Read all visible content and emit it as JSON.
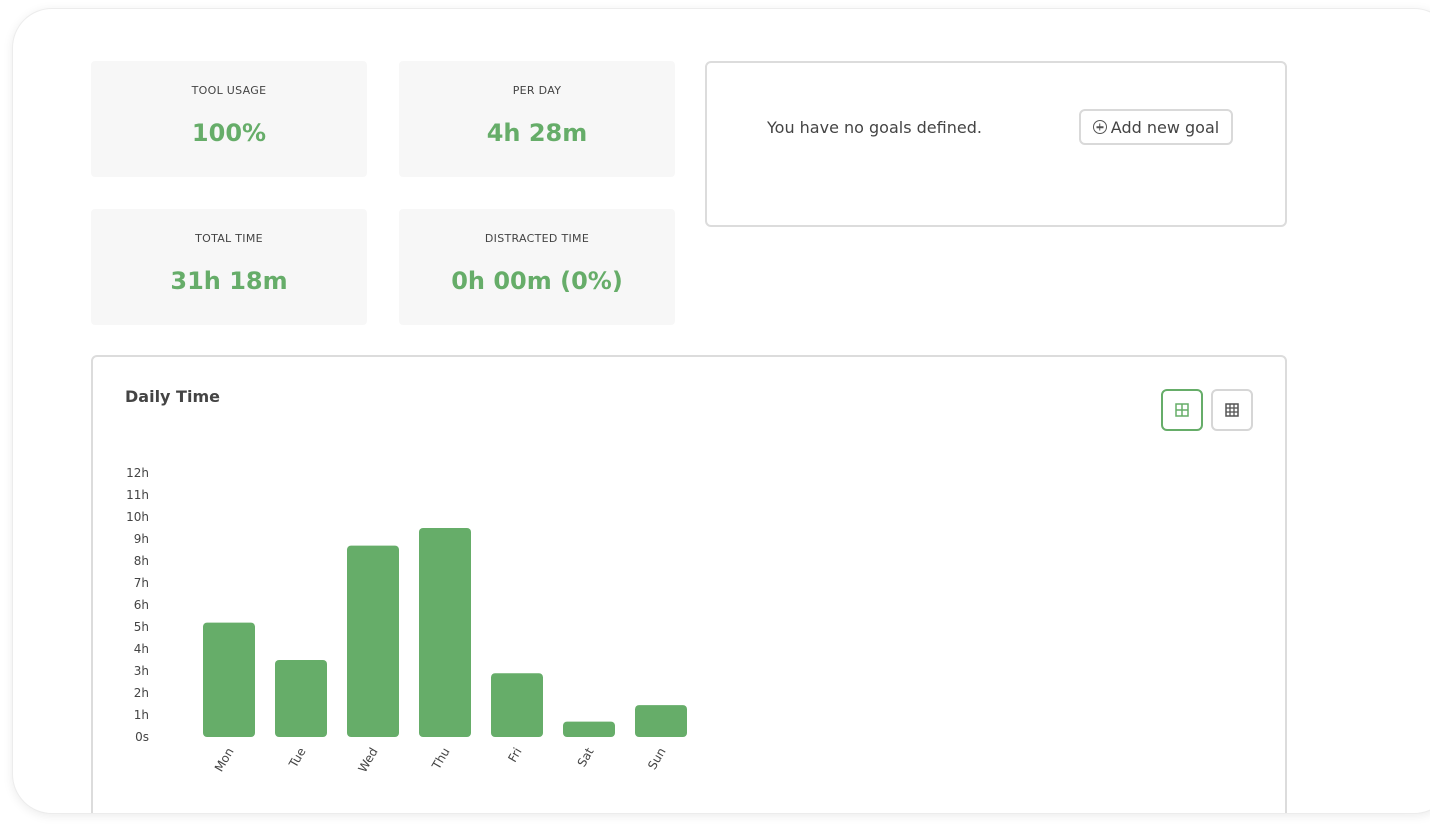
{
  "stats": {
    "tool_usage": {
      "label": "TOOL USAGE",
      "value": "100%"
    },
    "per_day": {
      "label": "PER DAY",
      "value": "4h 28m"
    },
    "total_time": {
      "label": "TOTAL TIME",
      "value": "31h 18m"
    },
    "distracted_time": {
      "label": "DISTRACTED TIME",
      "value": "0h 00m (0%)"
    }
  },
  "goals": {
    "empty_text": "You have no goals defined.",
    "add_button_label": "Add new goal",
    "add_icon": "plus-circle-icon"
  },
  "view_toggle": {
    "active_icon": "grid-2x2-icon",
    "inactive_icon": "grid-3x3-icon",
    "active_color": "#66ad69"
  },
  "colors": {
    "accent": "#66ad69",
    "bar": "#66ad69"
  },
  "chart_data": {
    "type": "bar",
    "title": "Daily Time",
    "categories": [
      "Mon",
      "Tue",
      "Wed",
      "Thu",
      "Fri",
      "Sat",
      "Sun"
    ],
    "values": [
      5.2,
      3.5,
      8.7,
      9.5,
      2.9,
      0.7,
      1.45
    ],
    "ylim": [
      0,
      12
    ],
    "yticks": [
      "0s",
      "1h",
      "2h",
      "3h",
      "4h",
      "5h",
      "6h",
      "7h",
      "8h",
      "9h",
      "10h",
      "11h",
      "12h"
    ],
    "xlabel": "",
    "ylabel": "",
    "grid": false
  }
}
